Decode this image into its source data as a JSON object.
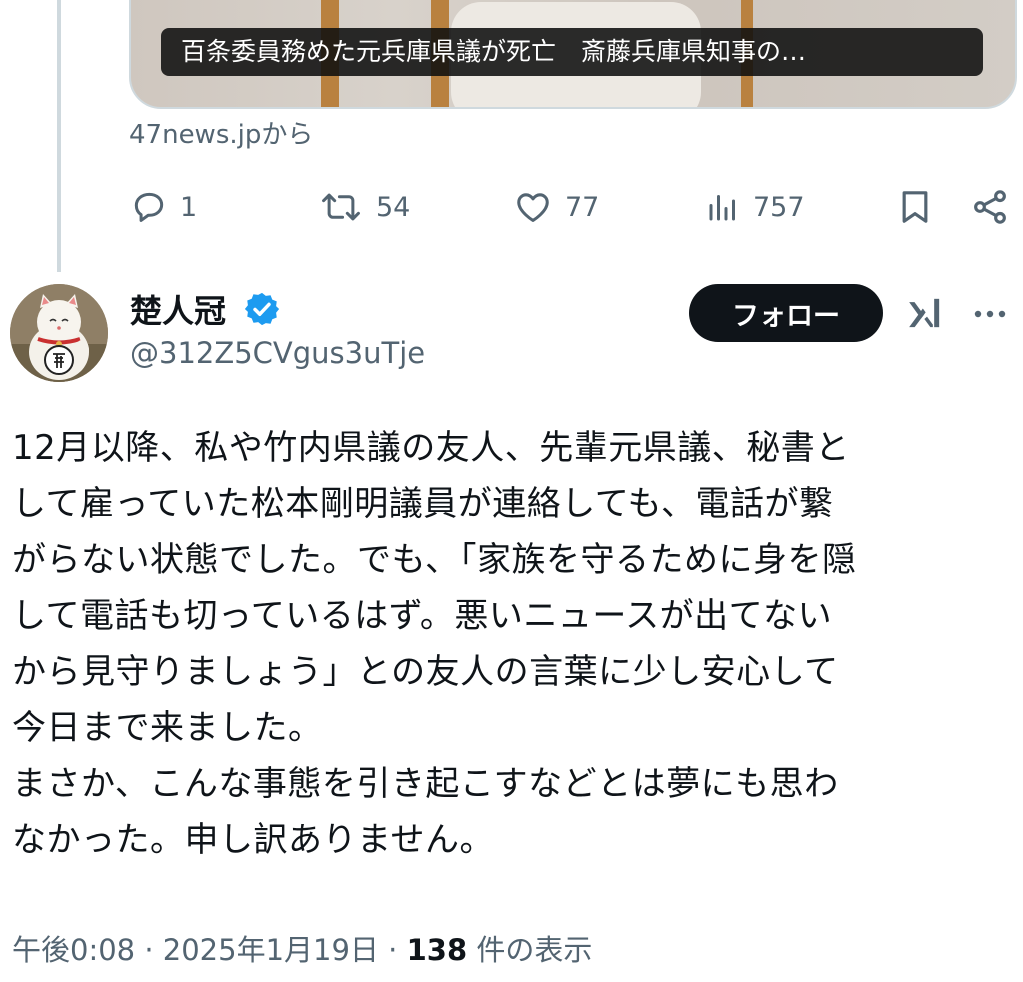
{
  "link_card": {
    "headline": "百条委員務めた元兵庫県議が死亡　斎藤兵庫県知事の…",
    "source": "47news.jpから"
  },
  "actions": {
    "replies": "1",
    "reposts": "54",
    "likes": "77",
    "views": "757"
  },
  "icons": {
    "reply": "reply-icon",
    "repost": "repost-icon",
    "like": "heart-icon",
    "views": "views-icon",
    "bookmark": "bookmark-icon",
    "share": "share-icon",
    "verified": "verified-badge-icon",
    "grok": "grok-icon",
    "more": "more-icon"
  },
  "author": {
    "name": "楚人冠",
    "handle": "@312Z5CVgus3uTje",
    "follow_label": "フォロー"
  },
  "tweet": {
    "text": "12月以降、私や竹内県議の友人、先輩元県議、秘書と\nして雇っていた松本剛明議員が連絡しても、電話が繋\nがらない状態でした。でも、「家族を守るために身を隠\nして電話も切っているはず。悪いニュースが出てない\nから見守りましょう」との友人の言葉に少し安心して\n今日まで来ました。\nまさか、こんな事態を引き起こすなどとは夢にも思わ\nなかった。申し訳ありません。"
  },
  "meta": {
    "time": "午後0:08 · 2025年1月19日 · ",
    "views_count": "138",
    "views_label": " 件の表示"
  },
  "colors": {
    "text": "#0f1419",
    "secondary": "#536471",
    "verified": "#1d9bf0",
    "border": "#cfd9de"
  }
}
